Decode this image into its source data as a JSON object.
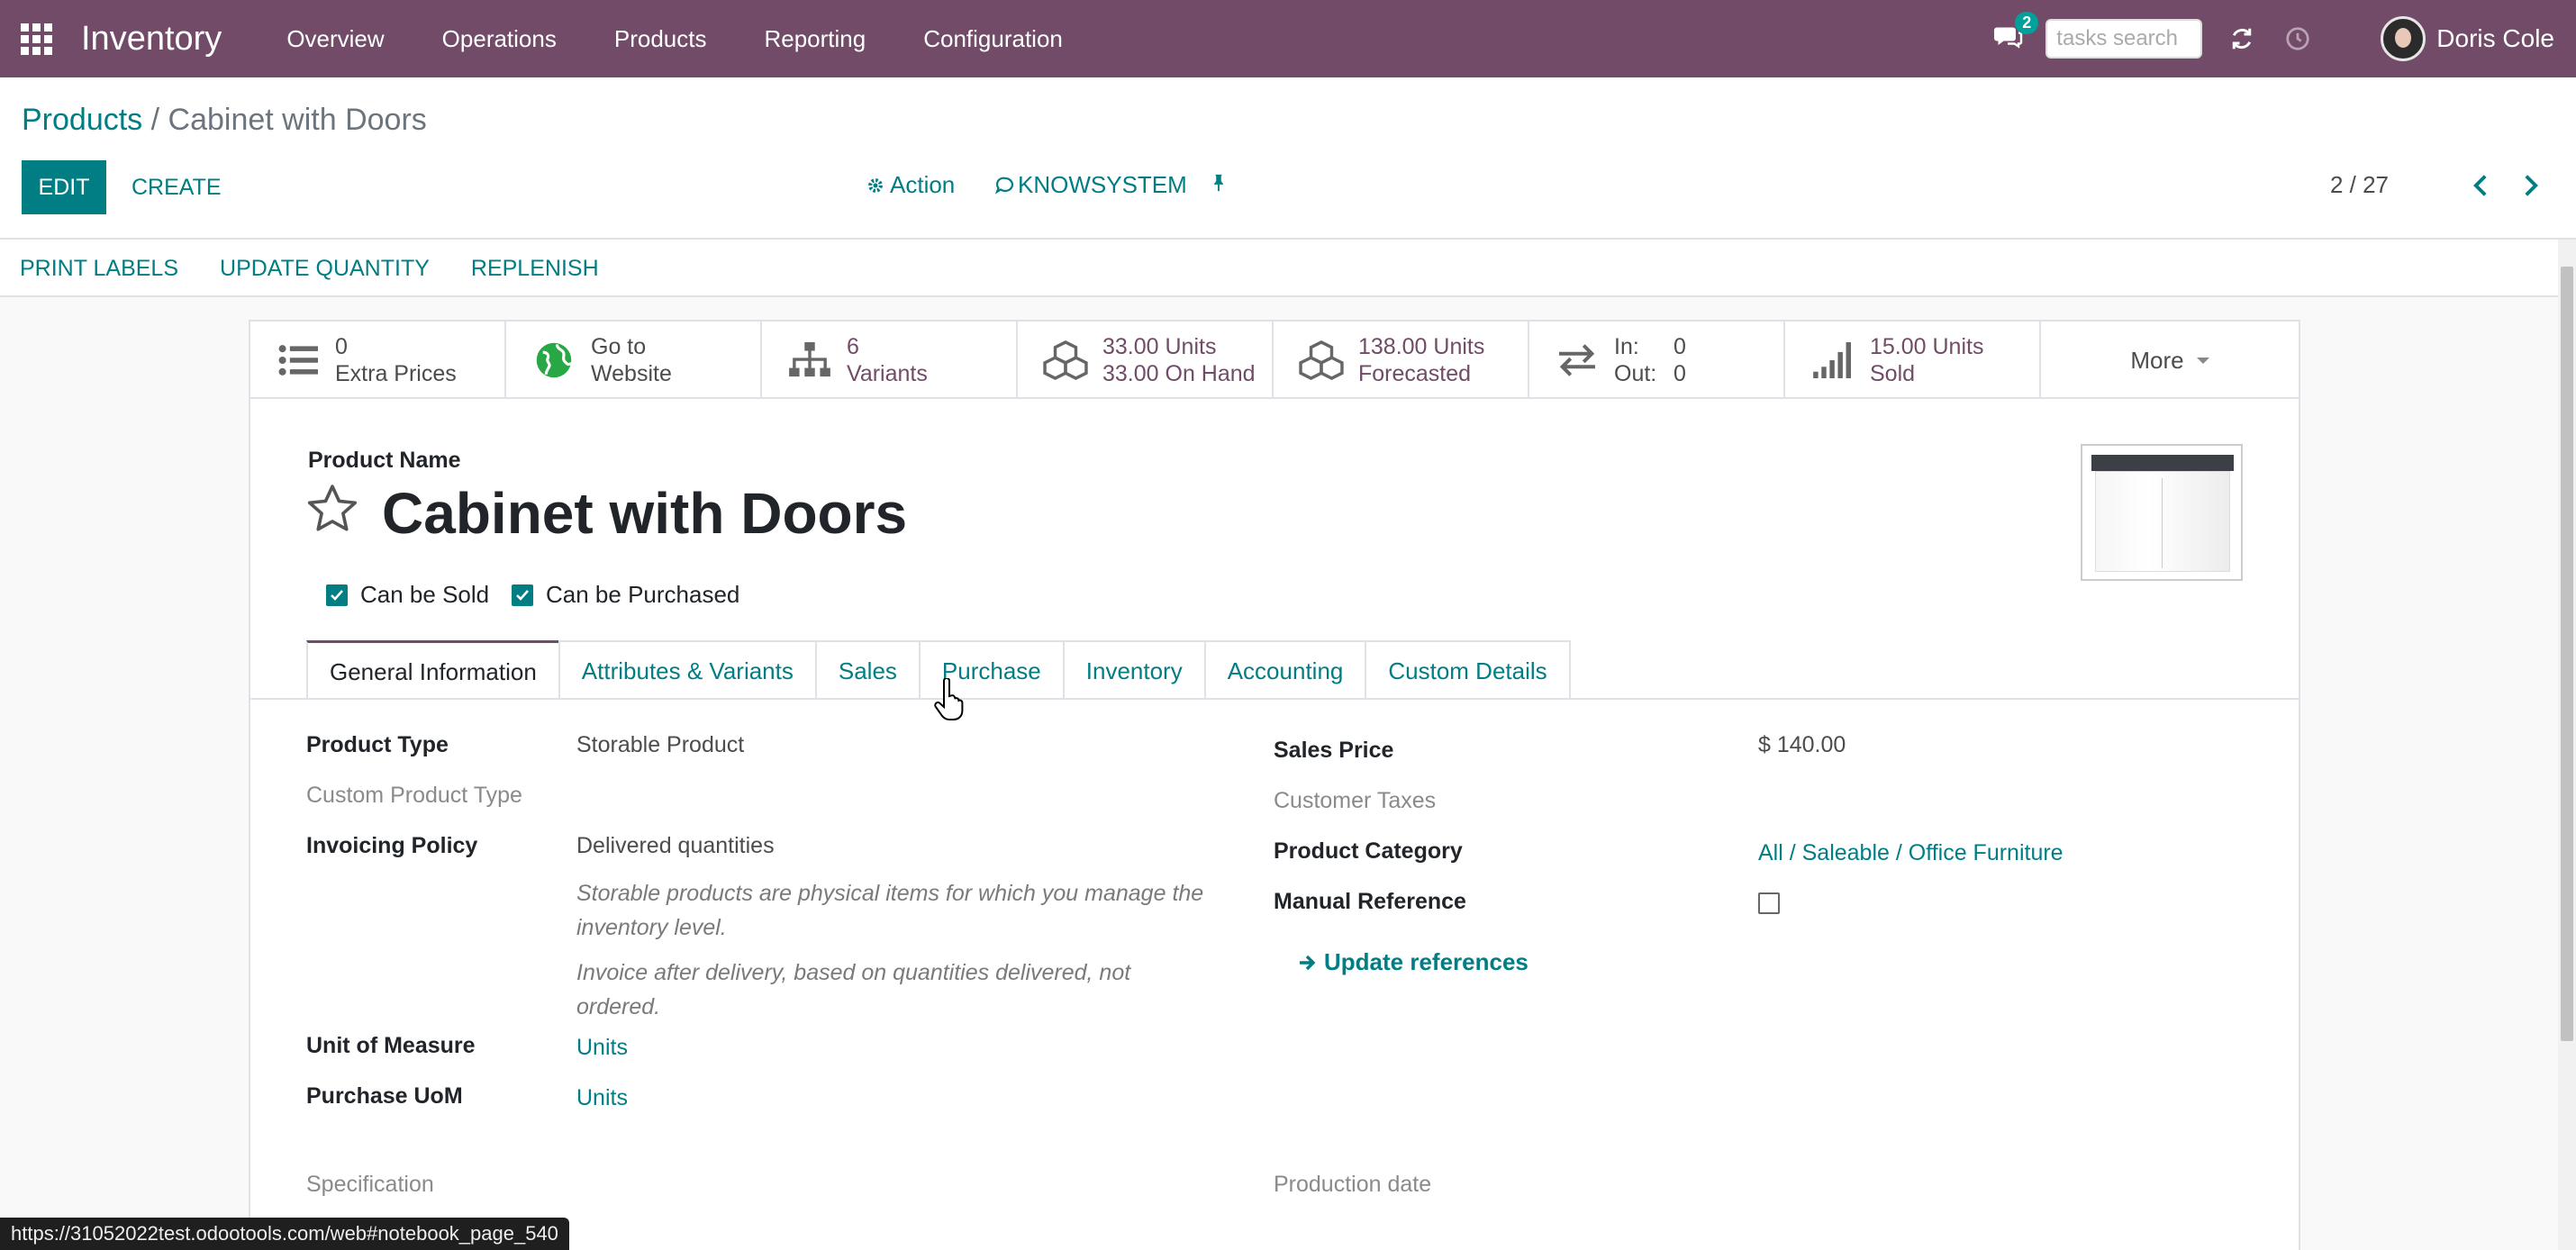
{
  "navbar": {
    "app_name": "Inventory",
    "menu": [
      "Overview",
      "Operations",
      "Products",
      "Reporting",
      "Configuration"
    ],
    "chat_badge": "2",
    "search_placeholder": "tasks search",
    "user_name": "Doris Cole"
  },
  "breadcrumb": {
    "parent": "Products",
    "separator": "/",
    "current": "Cabinet with Doors"
  },
  "toolbar": {
    "edit_label": "EDIT",
    "create_label": "CREATE",
    "action_label": "Action",
    "knowsystem_label": "KNOWSYSTEM",
    "pager": "2 / 27"
  },
  "status_buttons": [
    "PRINT LABELS",
    "UPDATE QUANTITY",
    "REPLENISH"
  ],
  "stats": {
    "extra_prices": {
      "value": "0",
      "label": "Extra Prices"
    },
    "website": {
      "value": "Go to",
      "label": "Website"
    },
    "variants": {
      "value": "6",
      "label": "Variants"
    },
    "on_hand": {
      "value": "33.00 Units",
      "label": "33.00 On Hand"
    },
    "forecasted": {
      "value": "138.00 Units",
      "label": "Forecasted"
    },
    "in_out": {
      "in_label": "In:",
      "in_value": "0",
      "out_label": "Out:",
      "out_value": "0"
    },
    "sold": {
      "value": "15.00 Units",
      "label": "Sold"
    },
    "more": "More"
  },
  "product": {
    "name_label": "Product Name",
    "name": "Cabinet with Doors",
    "can_be_sold": "Can be Sold",
    "can_be_purchased": "Can be Purchased"
  },
  "tabs": [
    "General Information",
    "Attributes & Variants",
    "Sales",
    "Purchase",
    "Inventory",
    "Accounting",
    "Custom Details"
  ],
  "left_fields": {
    "product_type_label": "Product Type",
    "product_type": "Storable Product",
    "custom_product_type_label": "Custom Product Type",
    "invoicing_policy_label": "Invoicing Policy",
    "invoicing_policy": "Delivered quantities",
    "help1": "Storable products are physical items for which you manage the inventory level.",
    "help2": "Invoice after delivery, based on quantities delivered, not ordered.",
    "uom_label": "Unit of Measure",
    "uom": "Units",
    "purchase_uom_label": "Purchase UoM",
    "purchase_uom": "Units",
    "specification_label": "Specification"
  },
  "right_fields": {
    "sales_price_label": "Sales Price",
    "sales_price": "$ 140.00",
    "customer_taxes_label": "Customer Taxes",
    "product_category_label": "Product Category",
    "product_category": "All / Saleable / Office Furniture",
    "manual_reference_label": "Manual Reference",
    "update_references": "Update references",
    "production_date_label": "Production date"
  },
  "url_tooltip": "https://31052022test.odootools.com/web#notebook_page_540"
}
